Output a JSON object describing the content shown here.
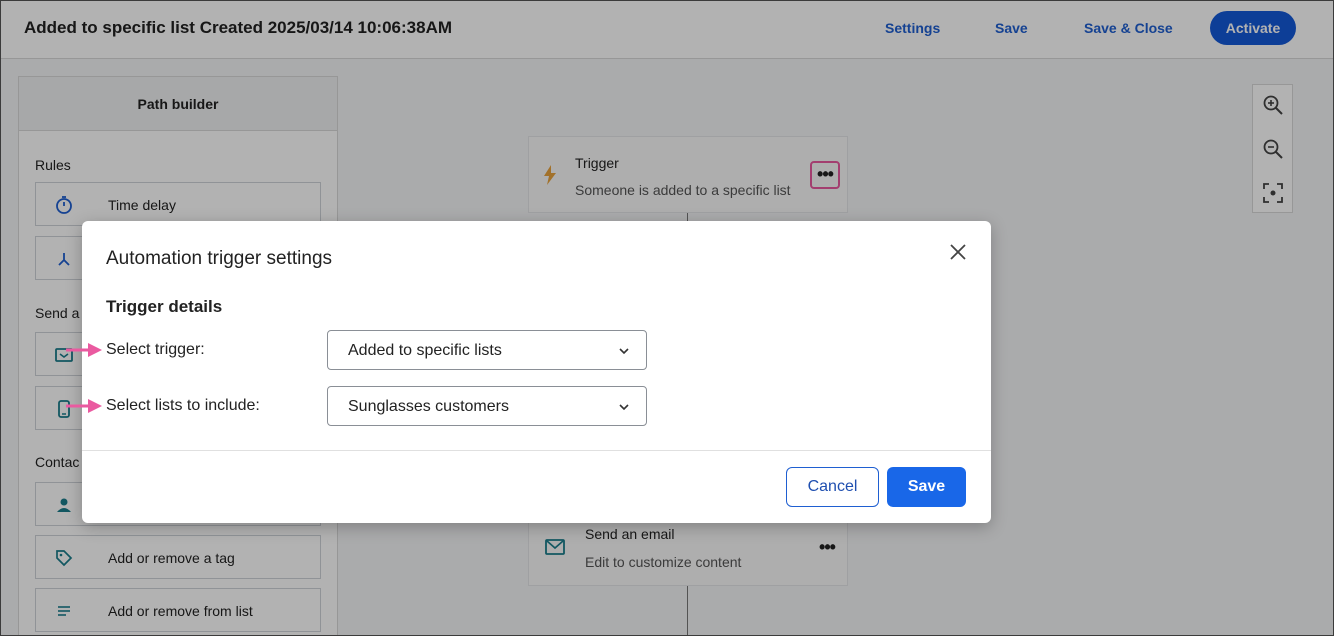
{
  "header": {
    "title": "Added to specific list Created 2025/03/14 10:06:38AM",
    "settings": "Settings",
    "save": "Save",
    "save_close": "Save & Close",
    "activate": "Activate"
  },
  "sidebar": {
    "title": "Path builder",
    "rules_label": "Rules",
    "send_label": "Send a",
    "contact_label": "Contac",
    "items": [
      {
        "label": "Time delay",
        "icon": "stopwatch-icon"
      },
      {
        "label": "",
        "icon": "split-icon"
      },
      {
        "label": "",
        "icon": "email-icon"
      },
      {
        "label": "",
        "icon": "mobile-icon"
      },
      {
        "label": "",
        "icon": "person-icon"
      },
      {
        "label": "Add or remove a tag",
        "icon": "tag-icon"
      },
      {
        "label": "Add or remove from list",
        "icon": "list-icon"
      }
    ]
  },
  "flow": {
    "trigger": {
      "title": "Trigger",
      "subtitle": "Someone is added to a specific list"
    },
    "email": {
      "title": "Send an email",
      "subtitle": "Edit to customize content"
    },
    "more": "•••"
  },
  "modal": {
    "title": "Automation trigger settings",
    "section": "Trigger details",
    "trigger_label": "Select trigger:",
    "trigger_value": "Added to specific lists",
    "lists_label": "Select lists to include:",
    "lists_value": "Sunglasses customers",
    "cancel": "Cancel",
    "save": "Save"
  },
  "colors": {
    "accent": "#1967e8",
    "highlight": "#ea5aa0",
    "trigger_icon": "#e8a33d",
    "icon_teal": "#1a7d8c"
  }
}
